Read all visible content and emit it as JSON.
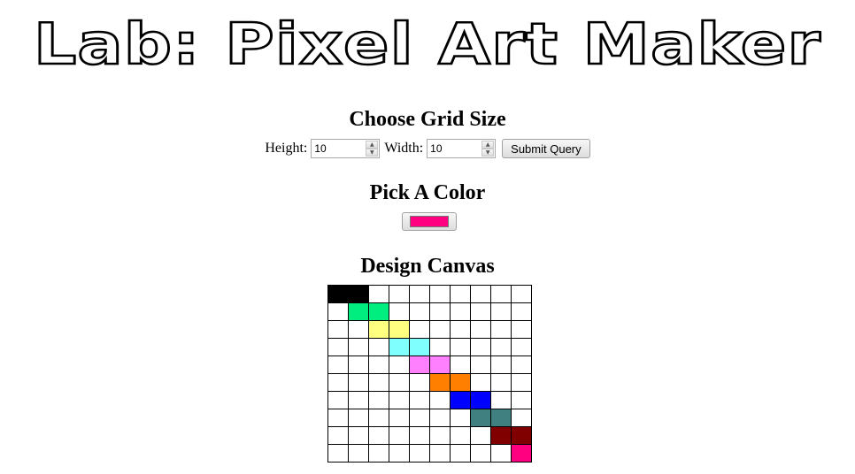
{
  "title": "Lab: Pixel Art Maker",
  "grid_size": {
    "heading": "Choose Grid Size",
    "height_label": "Height:",
    "height_value": "10",
    "width_label": "Width:",
    "width_value": "10",
    "submit_label": "Submit Query"
  },
  "color_picker": {
    "heading": "Pick A Color",
    "selected_color": "#ff0080"
  },
  "canvas": {
    "heading": "Design Canvas",
    "rows": 10,
    "cols": 10,
    "painted_cells": [
      {
        "row": 0,
        "col": 0,
        "color": "#000000"
      },
      {
        "row": 0,
        "col": 1,
        "color": "#000000"
      },
      {
        "row": 1,
        "col": 1,
        "color": "#00ee80"
      },
      {
        "row": 1,
        "col": 2,
        "color": "#00ee80"
      },
      {
        "row": 2,
        "col": 2,
        "color": "#ffff80"
      },
      {
        "row": 2,
        "col": 3,
        "color": "#ffff80"
      },
      {
        "row": 3,
        "col": 3,
        "color": "#80ffff"
      },
      {
        "row": 3,
        "col": 4,
        "color": "#80ffff"
      },
      {
        "row": 4,
        "col": 4,
        "color": "#ff80ff"
      },
      {
        "row": 4,
        "col": 5,
        "color": "#ff80ff"
      },
      {
        "row": 5,
        "col": 5,
        "color": "#ff8000"
      },
      {
        "row": 5,
        "col": 6,
        "color": "#ff8000"
      },
      {
        "row": 6,
        "col": 6,
        "color": "#0000ff"
      },
      {
        "row": 6,
        "col": 7,
        "color": "#0000ff"
      },
      {
        "row": 7,
        "col": 7,
        "color": "#408080"
      },
      {
        "row": 7,
        "col": 8,
        "color": "#408080"
      },
      {
        "row": 8,
        "col": 8,
        "color": "#800000"
      },
      {
        "row": 8,
        "col": 9,
        "color": "#800000"
      },
      {
        "row": 9,
        "col": 9,
        "color": "#ff0080"
      }
    ]
  }
}
